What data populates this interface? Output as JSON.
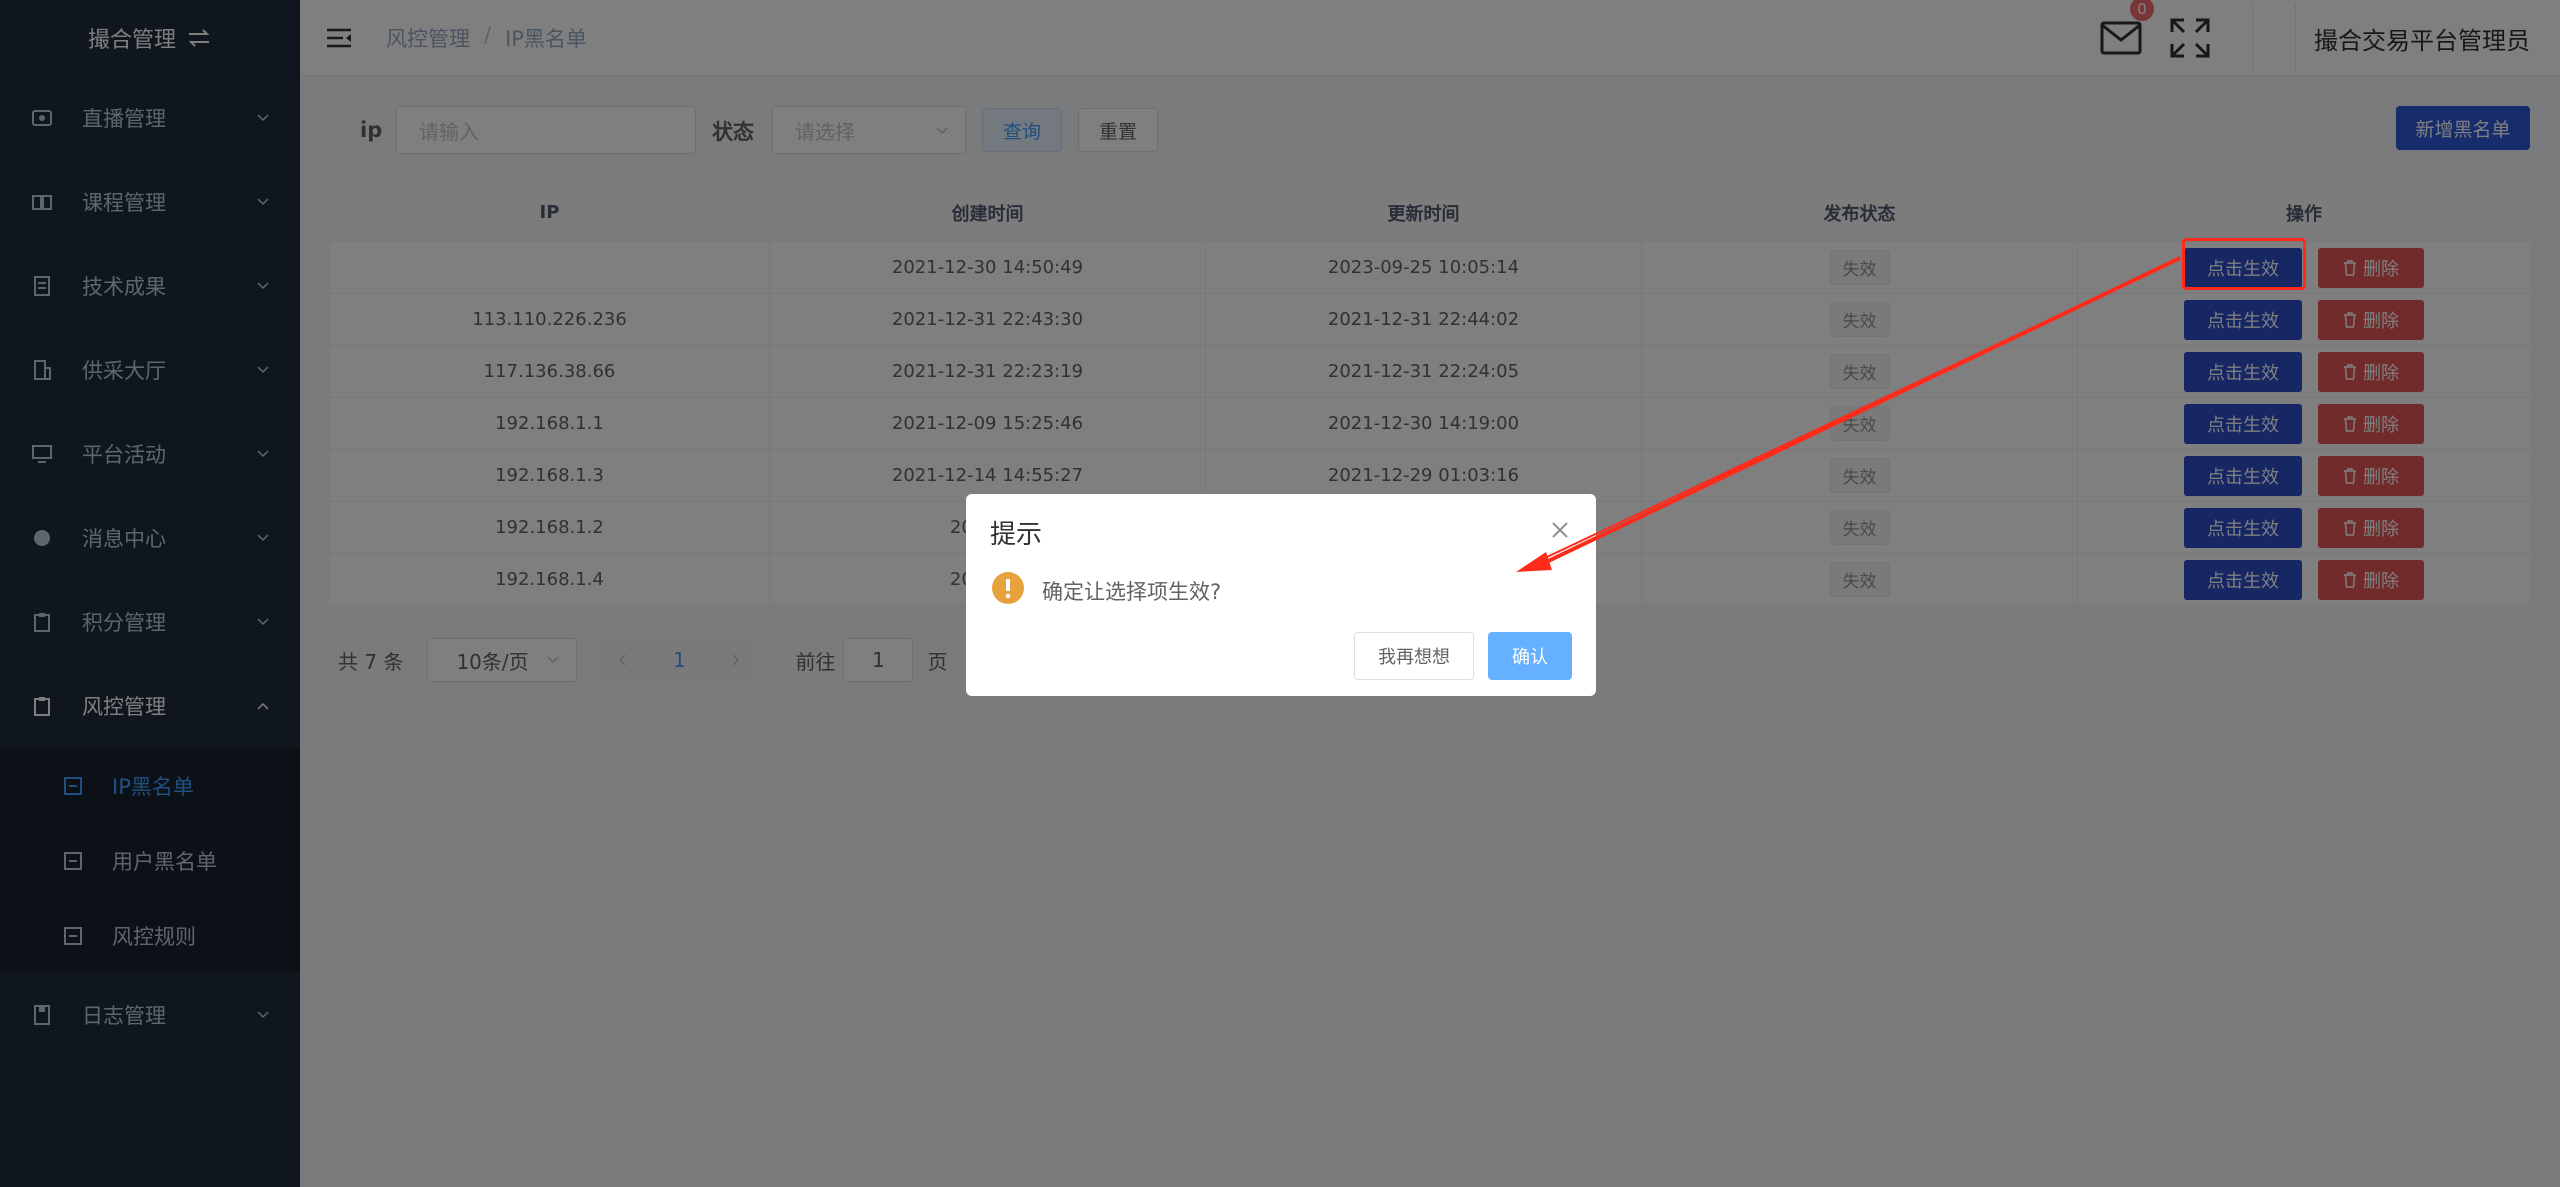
{
  "sidebar": {
    "brand": "撮合管理",
    "items": [
      {
        "label": "直播管理"
      },
      {
        "label": "课程管理"
      },
      {
        "label": "技术成果"
      },
      {
        "label": "供采大厅"
      },
      {
        "label": "平台活动"
      },
      {
        "label": "消息中心"
      },
      {
        "label": "积分管理"
      },
      {
        "label": "风控管理"
      },
      {
        "label": "日志管理"
      }
    ],
    "submenu": [
      {
        "label": "IP黑名单"
      },
      {
        "label": "用户黑名单"
      },
      {
        "label": "风控规则"
      }
    ]
  },
  "header": {
    "breadcrumb": [
      "风控管理",
      "IP黑名单"
    ],
    "mail_badge": "0",
    "username": "撮合交易平台管理员"
  },
  "search": {
    "ip_label": "ip",
    "ip_placeholder": "请输入",
    "status_label": "状态",
    "status_placeholder": "请选择",
    "query_label": "查询",
    "reset_label": "重置",
    "add_label": "新增黑名单"
  },
  "table": {
    "columns": [
      "IP",
      "创建时间",
      "更新时间",
      "发布状态",
      "操作"
    ],
    "rows": [
      {
        "ip": "",
        "created": "2021-12-30 14:50:49",
        "updated": "2023-09-25 10:05:14",
        "status": "失效",
        "effect": "点击生效",
        "delete": "删除"
      },
      {
        "ip": "113.110.226.236",
        "created": "2021-12-31 22:43:30",
        "updated": "2021-12-31 22:44:02",
        "status": "失效",
        "effect": "点击生效",
        "delete": "删除"
      },
      {
        "ip": "117.136.38.66",
        "created": "2021-12-31 22:23:19",
        "updated": "2021-12-31 22:24:05",
        "status": "失效",
        "effect": "点击生效",
        "delete": "删除"
      },
      {
        "ip": "192.168.1.1",
        "created": "2021-12-09 15:25:46",
        "updated": "2021-12-30 14:19:00",
        "status": "失效",
        "effect": "点击生效",
        "delete": "删除"
      },
      {
        "ip": "192.168.1.3",
        "created": "2021-12-14 14:55:27",
        "updated": "2021-12-29 01:03:16",
        "status": "失效",
        "effect": "点击生效",
        "delete": "删除"
      },
      {
        "ip": "192.168.1.2",
        "created": "2021-12",
        "updated": "",
        "status": "失效",
        "effect": "点击生效",
        "delete": "删除"
      },
      {
        "ip": "192.168.1.4",
        "created": "2021-12",
        "updated": "",
        "status": "失效",
        "effect": "点击生效",
        "delete": "删除"
      }
    ]
  },
  "pager": {
    "total": "共 7 条",
    "page_size": "10条/页",
    "current": "1",
    "goto_prefix": "前往",
    "goto_value": "1",
    "goto_suffix": "页"
  },
  "dialog": {
    "title": "提示",
    "message": "确定让选择项生效?",
    "cancel": "我再想想",
    "confirm": "确认"
  },
  "colors": {
    "sidebar_bg": "#1f2d3d",
    "accent": "#409eff",
    "effect_button": "#2c4fc9",
    "delete_button": "#e45656",
    "annotation": "#ff2a1a",
    "warning": "#e6a23c"
  }
}
